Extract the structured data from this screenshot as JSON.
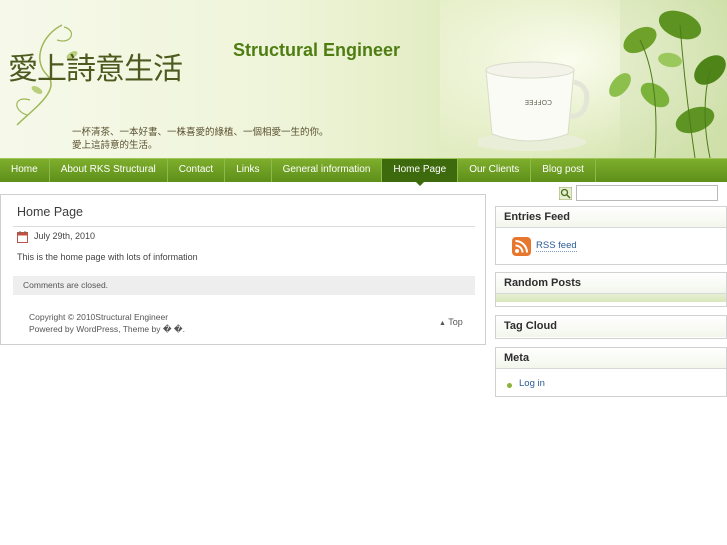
{
  "header": {
    "site_title": "Structural Engineer",
    "calligraphy_title": "愛上詩意生活",
    "calligraphy_line1": "一杯清茶、一本好書、一株喜愛的綠植、一個相愛一生的你。",
    "calligraphy_line2": "愛上這詩意的生活。"
  },
  "nav": {
    "items": [
      {
        "label": "Home"
      },
      {
        "label": "About RKS Structural"
      },
      {
        "label": "Contact"
      },
      {
        "label": "Links"
      },
      {
        "label": "General information"
      },
      {
        "label": "Home Page"
      },
      {
        "label": "Our Clients"
      },
      {
        "label": "Blog post"
      }
    ],
    "active_index": 5
  },
  "search": {
    "placeholder": ""
  },
  "post": {
    "title": "Home Page",
    "date": "July 29th, 2010",
    "body": "This is the home page with lots of information",
    "comments_status": "Comments are closed."
  },
  "footer": {
    "copyright": "Copyright © 2010Structural Engineer",
    "powered": "Powered by WordPress, Theme by � �.",
    "top_link": "Top"
  },
  "sidebar": {
    "entries_feed": {
      "title": "Entries Feed",
      "rss_label": "RSS feed"
    },
    "random_posts": {
      "title": "Random Posts"
    },
    "tag_cloud": {
      "title": "Tag Cloud"
    },
    "meta": {
      "title": "Meta",
      "login_label": "Log in"
    }
  },
  "colors": {
    "nav_bg": "#6a9c22",
    "nav_active": "#3d6a0c",
    "title_green": "#4f7d12",
    "link_blue": "#2b5d98"
  }
}
